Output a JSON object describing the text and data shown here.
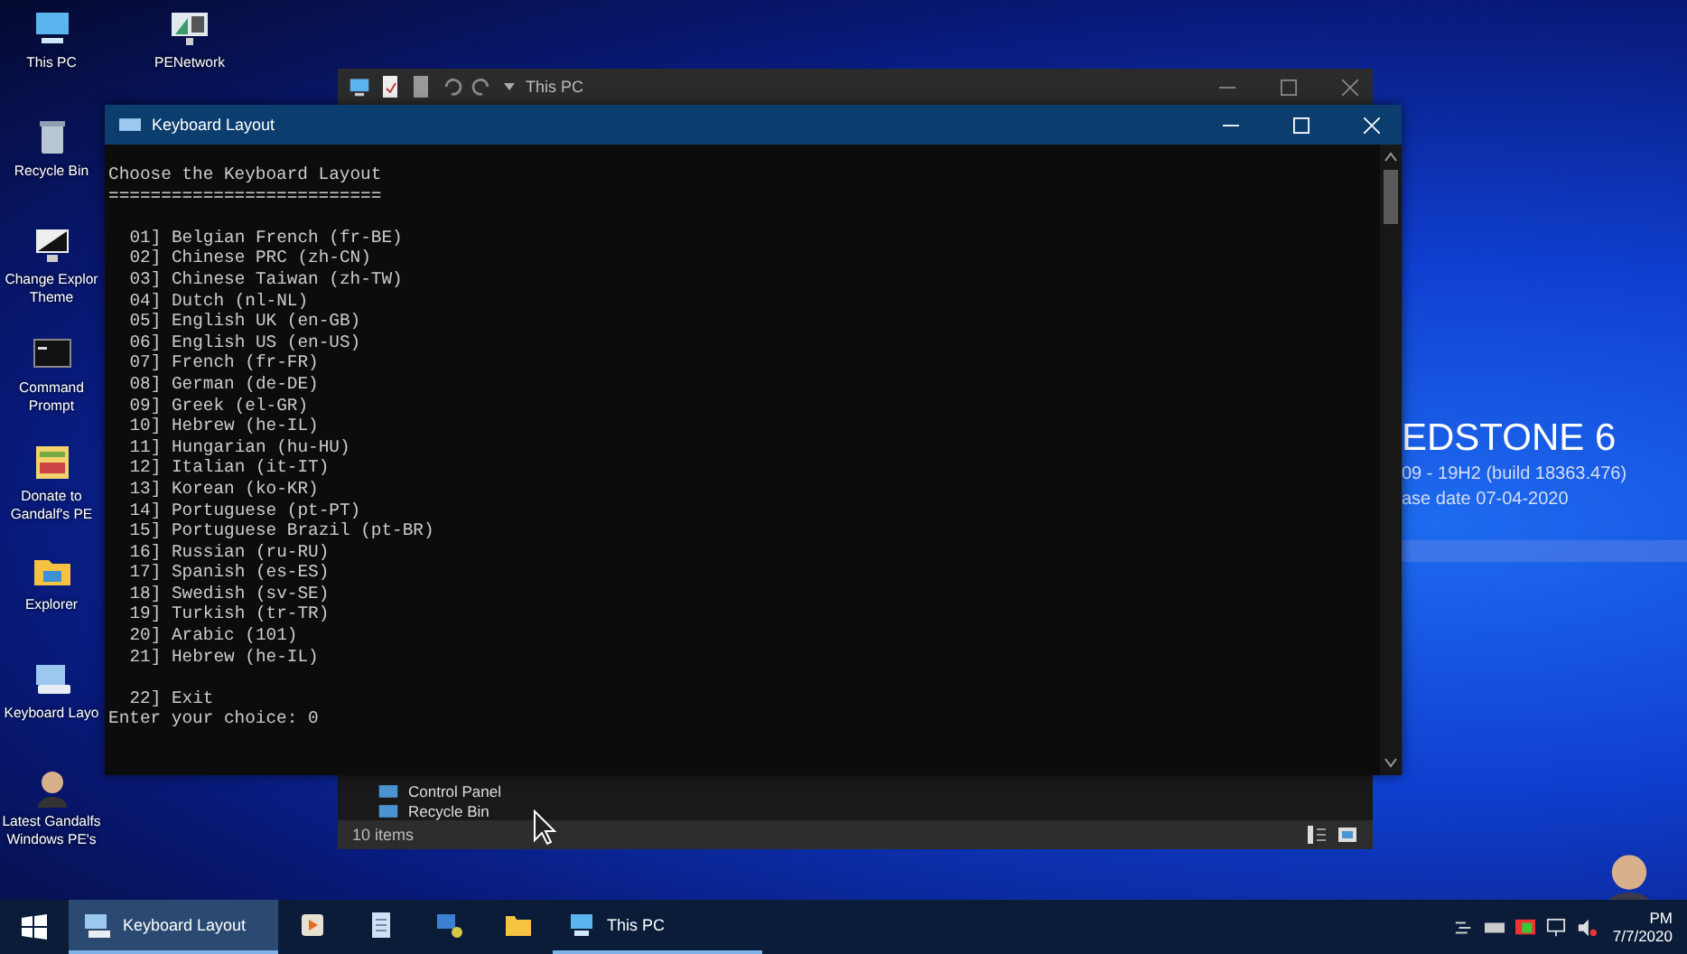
{
  "desktop": {
    "icons": [
      {
        "kind": "pc",
        "lines": [
          "This PC"
        ]
      },
      {
        "kind": "recycle",
        "lines": [
          "Recycle Bin"
        ]
      },
      {
        "kind": "monitor",
        "lines": [
          "Change Explor",
          "Theme"
        ]
      },
      {
        "kind": "cmd",
        "lines": [
          "Command",
          "Prompt"
        ]
      },
      {
        "kind": "donate",
        "lines": [
          "Donate to",
          "Gandalf's PE"
        ]
      },
      {
        "kind": "folder",
        "lines": [
          "Explorer"
        ]
      },
      {
        "kind": "keyboard",
        "lines": [
          "Keyboard Layo"
        ]
      },
      {
        "kind": "avatar",
        "lines": [
          "Latest Gandalfs",
          "Windows PE's"
        ]
      }
    ],
    "extra_icon": {
      "kind": "network",
      "lines": [
        "PENetwork"
      ]
    },
    "wallpaper_text": {
      "title": "EDSTONE 6",
      "build": "09 - 19H2 (build 18363.476)",
      "release": "ase date  07-04-2020"
    }
  },
  "explorer": {
    "title": "This PC",
    "items": [
      "Control Panel",
      "Recycle Bin"
    ],
    "status": "10 items"
  },
  "console": {
    "title": "Keyboard Layout",
    "heading": "Choose the Keyboard Layout",
    "rule": "==========================",
    "options": [
      "01] Belgian French (fr-BE)",
      "02] Chinese PRC (zh-CN)",
      "03] Chinese Taiwan (zh-TW)",
      "04] Dutch (nl-NL)",
      "05] English UK (en-GB)",
      "06] English US (en-US)",
      "07] French (fr-FR)",
      "08] German (de-DE)",
      "09] Greek (el-GR)",
      "10] Hebrew (he-IL)",
      "11] Hungarian (hu-HU)",
      "12] Italian (it-IT)",
      "13] Korean (ko-KR)",
      "14] Portuguese (pt-PT)",
      "15] Portuguese Brazil (pt-BR)",
      "16] Russian (ru-RU)",
      "17] Spanish (es-ES)",
      "18] Swedish (sv-SE)",
      "19] Turkish (tr-TR)",
      "20] Arabic (101)",
      "21] Hebrew (he-IL)"
    ],
    "exit_option": "22] Exit",
    "prompt": "Enter your choice: 0"
  },
  "taskbar": {
    "items": [
      {
        "kind": "keyboard",
        "label": "Keyboard Layout",
        "selected": true,
        "running": true
      },
      {
        "kind": "media",
        "selected": false,
        "running": false
      },
      {
        "kind": "notepad",
        "selected": false,
        "running": false
      },
      {
        "kind": "network",
        "selected": false,
        "running": false
      },
      {
        "kind": "folder",
        "selected": false,
        "running": false
      },
      {
        "kind": "pc",
        "label": "This PC",
        "selected": false,
        "running": true
      }
    ],
    "clock": {
      "time": "PM",
      "date": "7/7/2020"
    }
  }
}
